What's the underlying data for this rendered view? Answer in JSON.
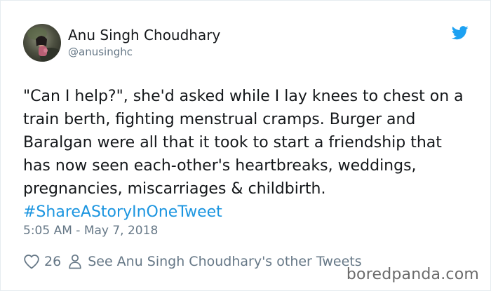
{
  "tweet": {
    "author": {
      "display_name": "Anu Singh Choudhary",
      "handle": "@anusinghc",
      "avatar_icon": "profile-photo"
    },
    "text_before_hashtag": "\"Can I help?\", she'd asked while I lay knees to chest on a train berth, fighting menstrual cramps. Burger and Baralgan were all that it took to start a friendship that has now seen each-other's heartbreaks, weddings, pregnancies, miscarriages & childbirth. ",
    "hashtag": "#ShareAStoryInOneTweet",
    "timestamp": "5:05 AM - May 7, 2018",
    "likes": "26",
    "profile_link_text": "See Anu Singh Choudhary's other Tweets",
    "brand_icon": "twitter-bird-icon"
  },
  "watermark": {
    "text": "boredpanda.com",
    "note_logo": "watermark"
  },
  "colors": {
    "text": "#14171a",
    "secondary": "#657786",
    "link": "#1b95e0",
    "twitter_blue": "#1da1f2",
    "border": "#e6ecf0"
  }
}
